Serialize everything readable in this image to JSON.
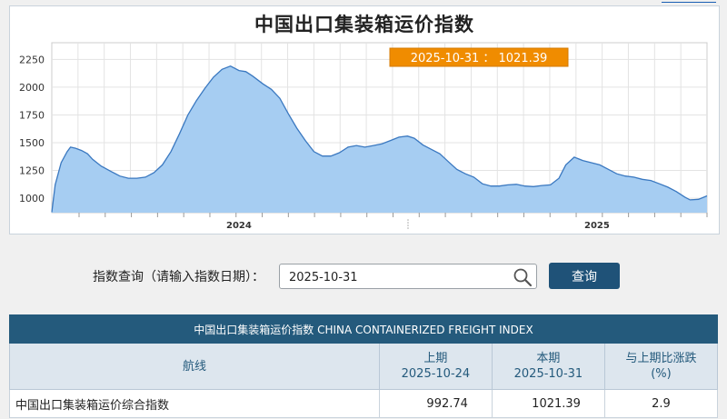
{
  "chart": {
    "title": "中国出口集装箱运价指数",
    "tooltip": {
      "date": "2025-10-31",
      "separator": "：",
      "value": "1021.39"
    }
  },
  "chart_data": {
    "type": "area",
    "x_ticks": [
      "2024",
      "2025"
    ],
    "ylim": [
      870,
      2400
    ],
    "y_ticks": [
      1000,
      1250,
      1500,
      1750,
      2000,
      2250
    ],
    "grid": true,
    "fill_color": "#a6cdf2",
    "line_color": "#3a78c0",
    "points": [
      [
        0,
        875
      ],
      [
        4,
        1120
      ],
      [
        11,
        1320
      ],
      [
        18,
        1420
      ],
      [
        22,
        1460
      ],
      [
        28,
        1450
      ],
      [
        35,
        1430
      ],
      [
        42,
        1400
      ],
      [
        48,
        1350
      ],
      [
        58,
        1290
      ],
      [
        70,
        1240
      ],
      [
        80,
        1200
      ],
      [
        90,
        1180
      ],
      [
        100,
        1180
      ],
      [
        110,
        1190
      ],
      [
        120,
        1230
      ],
      [
        130,
        1300
      ],
      [
        140,
        1420
      ],
      [
        150,
        1580
      ],
      [
        160,
        1750
      ],
      [
        170,
        1880
      ],
      [
        180,
        1990
      ],
      [
        190,
        2090
      ],
      [
        200,
        2160
      ],
      [
        210,
        2190
      ],
      [
        220,
        2150
      ],
      [
        228,
        2140
      ],
      [
        236,
        2100
      ],
      [
        248,
        2030
      ],
      [
        258,
        1980
      ],
      [
        268,
        1900
      ],
      [
        278,
        1760
      ],
      [
        288,
        1630
      ],
      [
        298,
        1520
      ],
      [
        308,
        1420
      ],
      [
        318,
        1380
      ],
      [
        328,
        1380
      ],
      [
        338,
        1410
      ],
      [
        348,
        1460
      ],
      [
        358,
        1475
      ],
      [
        368,
        1460
      ],
      [
        378,
        1475
      ],
      [
        388,
        1490
      ],
      [
        398,
        1520
      ],
      [
        408,
        1550
      ],
      [
        418,
        1560
      ],
      [
        426,
        1540
      ],
      [
        436,
        1480
      ],
      [
        446,
        1440
      ],
      [
        456,
        1400
      ],
      [
        466,
        1330
      ],
      [
        476,
        1260
      ],
      [
        486,
        1220
      ],
      [
        496,
        1190
      ],
      [
        506,
        1130
      ],
      [
        516,
        1110
      ],
      [
        526,
        1110
      ],
      [
        536,
        1120
      ],
      [
        546,
        1125
      ],
      [
        556,
        1110
      ],
      [
        566,
        1105
      ],
      [
        576,
        1115
      ],
      [
        586,
        1120
      ],
      [
        596,
        1180
      ],
      [
        604,
        1300
      ],
      [
        614,
        1370
      ],
      [
        624,
        1340
      ],
      [
        634,
        1320
      ],
      [
        644,
        1300
      ],
      [
        654,
        1260
      ],
      [
        664,
        1220
      ],
      [
        674,
        1200
      ],
      [
        684,
        1190
      ],
      [
        694,
        1170
      ],
      [
        704,
        1160
      ],
      [
        714,
        1130
      ],
      [
        724,
        1100
      ],
      [
        734,
        1060
      ],
      [
        744,
        1010
      ],
      [
        750,
        985
      ],
      [
        760,
        990
      ],
      [
        770,
        1021.39
      ]
    ]
  },
  "query": {
    "label": "指数查询（请输入指数日期）：",
    "value": "2025-10-31",
    "button": "查询"
  },
  "table": {
    "caption": "中国出口集装箱运价指数 CHINA CONTAINERIZED FREIGHT INDEX",
    "headers": {
      "route": "航线",
      "prev_label": "上期",
      "prev_date": "2025-10-24",
      "curr_label": "本期",
      "curr_date": "2025-10-31",
      "change_label": "与上期比涨跌",
      "change_unit": "(%)"
    },
    "rows": [
      {
        "route": "中国出口集装箱运价综合指数",
        "prev": "992.74",
        "curr": "1021.39",
        "change": "2.9"
      }
    ]
  }
}
